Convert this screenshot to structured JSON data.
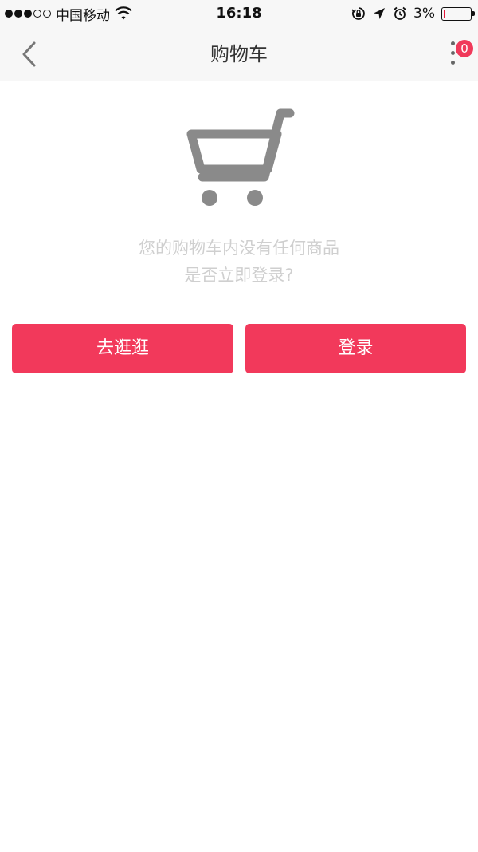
{
  "status_bar": {
    "carrier": "中国移动",
    "time": "16:18",
    "battery_percent_label": "3%",
    "battery_level": 0.03,
    "signal_bars_filled": 3,
    "signal_bars_total": 5
  },
  "nav": {
    "title": "购物车",
    "badge_count": "0"
  },
  "empty_state": {
    "line1": "您的购物车内没有任何商品",
    "line2": "是否立即登录?"
  },
  "actions": {
    "browse_label": "去逛逛",
    "login_label": "登录"
  },
  "colors": {
    "accent": "#f2395b",
    "muted_text": "#cfcfcf",
    "cart_icon": "#8a8a8a"
  },
  "icons": {
    "back": "chevron-left-icon",
    "more": "more-vertical-icon",
    "cart": "shopping-cart-icon"
  }
}
